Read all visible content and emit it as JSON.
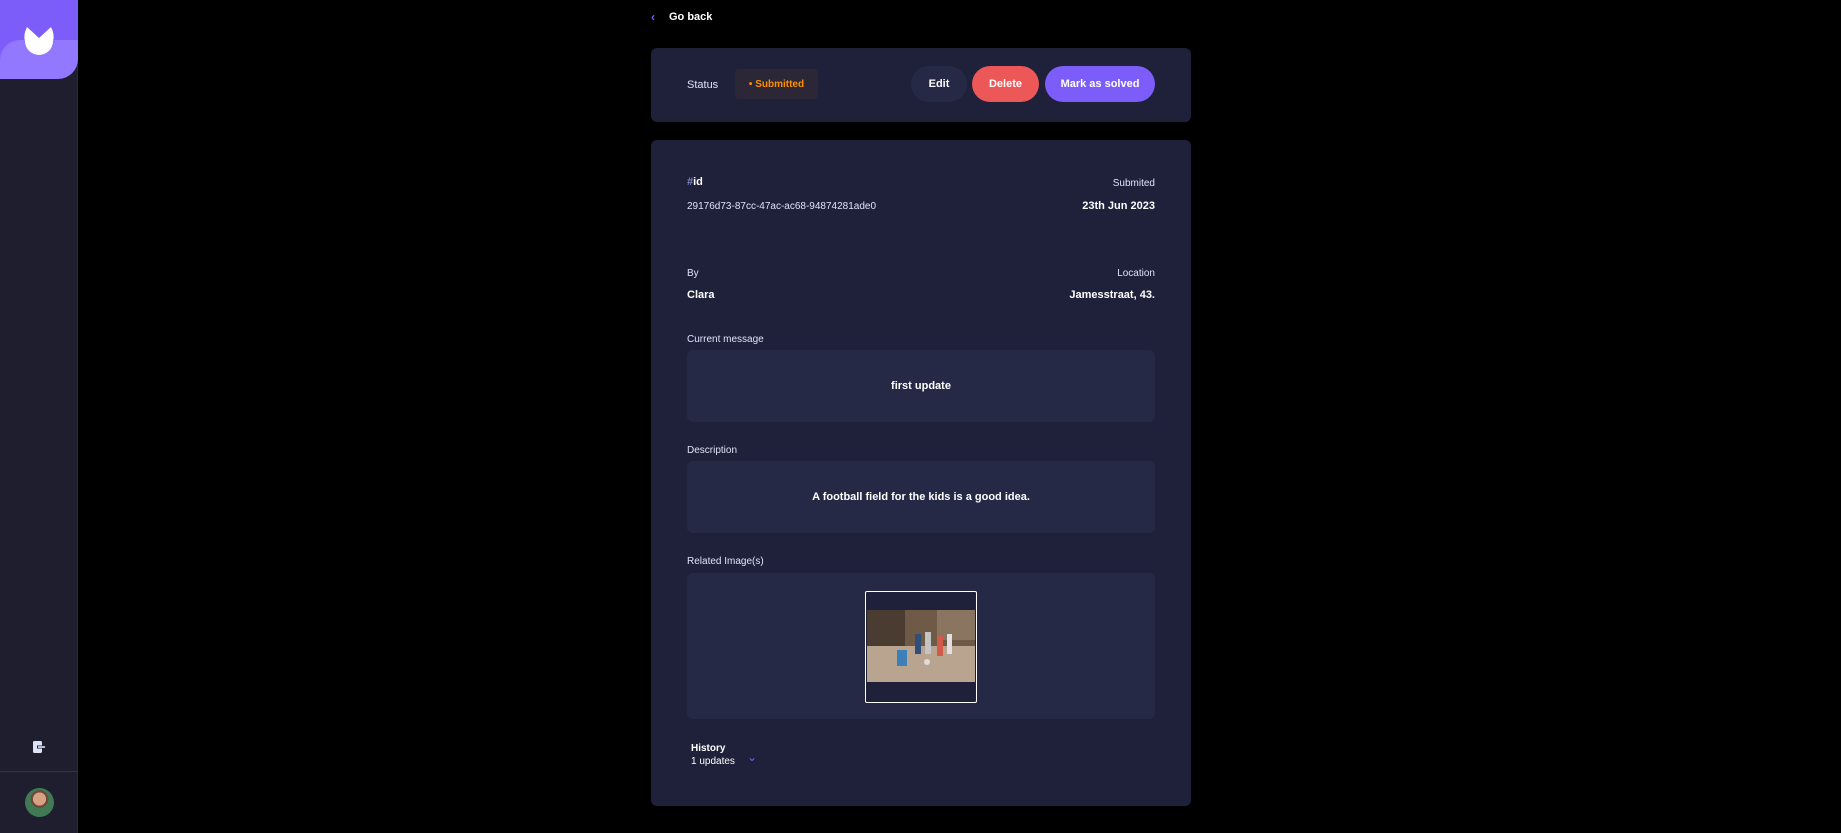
{
  "colors": {
    "accent": "#7c5dfa",
    "danger": "#ec5757",
    "pending": "#ff8f00",
    "card": "#1e2139",
    "inner": "#252945"
  },
  "nav": {
    "back_label": "Go back"
  },
  "status": {
    "label": "Status",
    "value": "Submitted"
  },
  "actions": {
    "edit": "Edit",
    "delete": "Delete",
    "solve": "Mark as solved"
  },
  "report": {
    "id_hash": "#",
    "id_label": "id",
    "id_value": "29176d73-87cc-47ac-ac68-94874281ade0",
    "submitted_label": "Submited",
    "submitted_value": "23th Jun 2023",
    "by_label": "By",
    "by_value": "Clara",
    "location_label": "Location",
    "location_value": "Jamesstraat, 43.",
    "message_label": "Current message",
    "message_value": "first update",
    "description_label": "Description",
    "description_value": "A football field for the kids is a good idea.",
    "images_label": "Related Image(s)"
  },
  "history": {
    "title": "History",
    "count": "1 updates"
  },
  "icons": {
    "logo": "brand-logo-icon",
    "logout": "logout-icon",
    "back": "chevron-left-icon",
    "expand": "chevron-down-icon"
  }
}
